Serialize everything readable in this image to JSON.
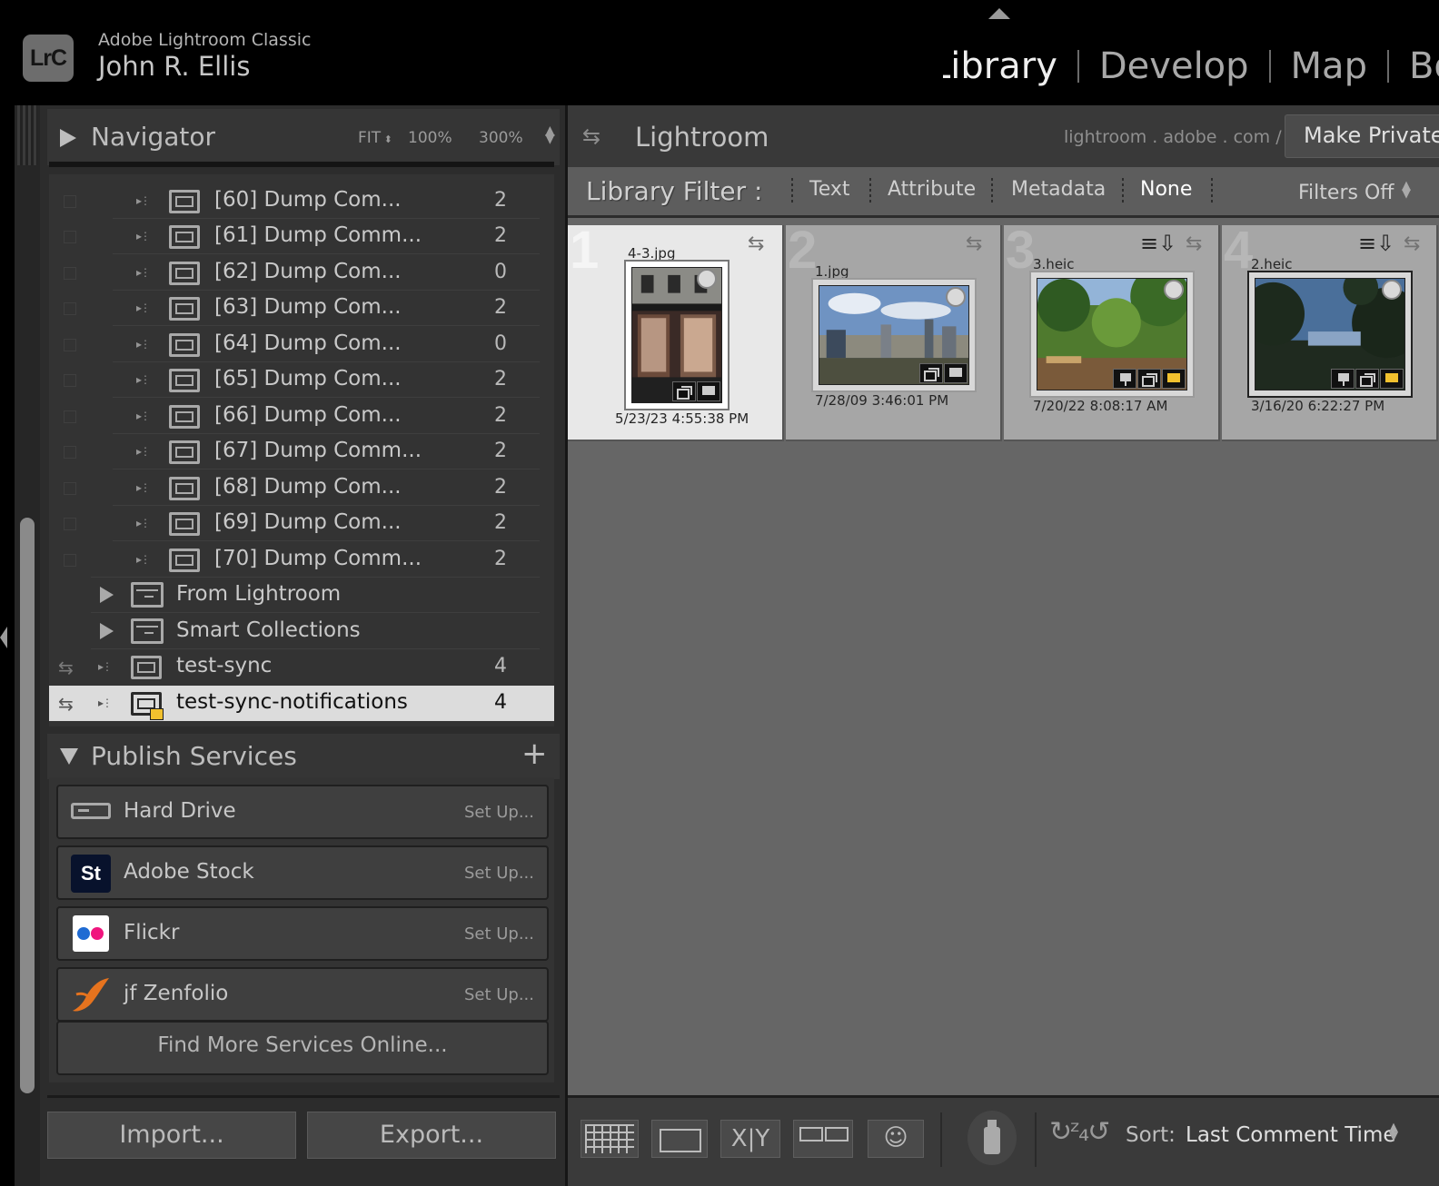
{
  "app": {
    "logo": "LrC",
    "name": "Adobe Lightroom Classic",
    "user": "John R. Ellis"
  },
  "modules": [
    "Library",
    "Develop",
    "Map",
    "Book"
  ],
  "active_module": "Library",
  "navigator": {
    "title": "Navigator",
    "zoom_fit": "FIT",
    "zoom_100": "100%",
    "zoom_300": "300%"
  },
  "collections": [
    {
      "label": "[60] Dump Com...",
      "count": "2"
    },
    {
      "label": "[61] Dump Comm...",
      "count": "2"
    },
    {
      "label": "[62] Dump Com...",
      "count": "0"
    },
    {
      "label": "[63] Dump Com...",
      "count": "2"
    },
    {
      "label": "[64] Dump Com...",
      "count": "0"
    },
    {
      "label": "[65] Dump Com...",
      "count": "2"
    },
    {
      "label": "[66] Dump Com...",
      "count": "2"
    },
    {
      "label": "[67] Dump Comm...",
      "count": "2"
    },
    {
      "label": "[68] Dump Com...",
      "count": "2"
    },
    {
      "label": "[69] Dump Com...",
      "count": "2"
    },
    {
      "label": "[70] Dump Comm...",
      "count": "2"
    }
  ],
  "collection_sets": [
    {
      "label": "From Lightroom"
    },
    {
      "label": "Smart Collections"
    }
  ],
  "synced_collections": [
    {
      "label": "test-sync",
      "count": "4"
    },
    {
      "label": "test-sync-notifications",
      "count": "4"
    }
  ],
  "publish": {
    "title": "Publish Services",
    "add_icon": "+",
    "services": [
      {
        "name": "Hard Drive",
        "setup": "Set Up..."
      },
      {
        "name": "Adobe Stock",
        "setup": "Set Up...",
        "icon_text": "St"
      },
      {
        "name": "Flickr",
        "setup": "Set Up..."
      },
      {
        "name": "jf Zenfolio",
        "setup": "Set Up..."
      }
    ],
    "find_more": "Find More Services Online..."
  },
  "bottom_buttons": {
    "import": "Import...",
    "export": "Export..."
  },
  "center": {
    "title": "Lightroom",
    "url": "lightroom . adobe . com /",
    "make_private": "Make Private"
  },
  "filter": {
    "label": "Library Filter :",
    "tabs": [
      "Text",
      "Attribute",
      "Metadata",
      "None"
    ],
    "active_tab": "None",
    "preset": "Filters Off"
  },
  "grid": [
    {
      "index": "1",
      "file": "4-3.jpg",
      "date": "5/23/23 4:55:38 PM",
      "selected": true
    },
    {
      "index": "2",
      "file": "1.jpg",
      "date": "7/28/09 3:46:01 PM",
      "selected": false
    },
    {
      "index": "3",
      "file": "3.heic",
      "date": "7/20/22 8:08:17 AM",
      "selected": false
    },
    {
      "index": "4",
      "file": "2.heic",
      "date": "3/16/20 6:22:27 PM",
      "selected": false
    }
  ],
  "toolbar": {
    "compare_glyph": "X|Y",
    "sort_label": "Sort:",
    "sort_value": "Last Comment Time"
  }
}
